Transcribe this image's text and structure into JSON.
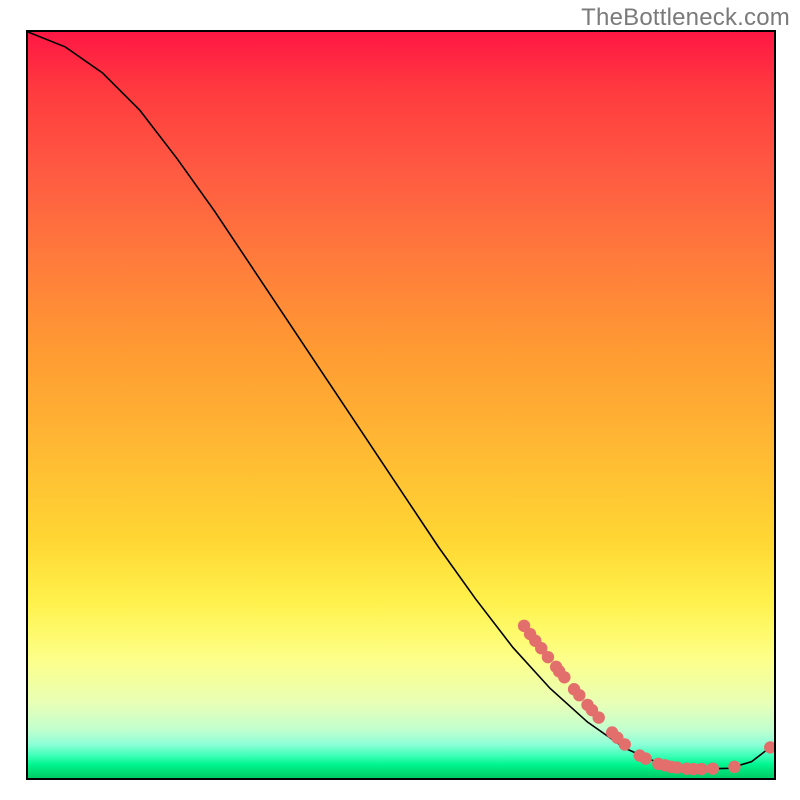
{
  "watermark": "TheBottleneck.com",
  "chart_data": {
    "type": "line",
    "title": "",
    "xlabel": "",
    "ylabel": "",
    "xlim": [
      0,
      100
    ],
    "ylim": [
      0,
      100
    ],
    "series": [
      {
        "name": "bottleneck-curve",
        "points": [
          {
            "x": 0,
            "y": 100
          },
          {
            "x": 5,
            "y": 98
          },
          {
            "x": 10,
            "y": 94.5
          },
          {
            "x": 15,
            "y": 89.5
          },
          {
            "x": 20,
            "y": 83
          },
          {
            "x": 25,
            "y": 76
          },
          {
            "x": 30,
            "y": 68.5
          },
          {
            "x": 35,
            "y": 61
          },
          {
            "x": 40,
            "y": 53.5
          },
          {
            "x": 45,
            "y": 46
          },
          {
            "x": 50,
            "y": 38.5
          },
          {
            "x": 55,
            "y": 31
          },
          {
            "x": 60,
            "y": 24
          },
          {
            "x": 65,
            "y": 17.5
          },
          {
            "x": 70,
            "y": 12
          },
          {
            "x": 75,
            "y": 7.5
          },
          {
            "x": 80,
            "y": 4
          },
          {
            "x": 85,
            "y": 1.8
          },
          {
            "x": 90,
            "y": 1.2
          },
          {
            "x": 94,
            "y": 1.3
          },
          {
            "x": 97,
            "y": 2.2
          },
          {
            "x": 100,
            "y": 4.5
          }
        ]
      }
    ],
    "markers": [
      {
        "x": 66.5,
        "y": 20.4
      },
      {
        "x": 67.3,
        "y": 19.3
      },
      {
        "x": 68.0,
        "y": 18.4
      },
      {
        "x": 68.8,
        "y": 17.4
      },
      {
        "x": 69.7,
        "y": 16.2
      },
      {
        "x": 70.8,
        "y": 14.9
      },
      {
        "x": 71.2,
        "y": 14.3
      },
      {
        "x": 71.9,
        "y": 13.5
      },
      {
        "x": 73.2,
        "y": 11.9
      },
      {
        "x": 73.9,
        "y": 11.1
      },
      {
        "x": 75.0,
        "y": 9.8
      },
      {
        "x": 75.6,
        "y": 9.1
      },
      {
        "x": 76.5,
        "y": 8.1
      },
      {
        "x": 78.3,
        "y": 6.1
      },
      {
        "x": 79.0,
        "y": 5.4
      },
      {
        "x": 80.0,
        "y": 4.5
      },
      {
        "x": 82.0,
        "y": 3.0
      },
      {
        "x": 82.8,
        "y": 2.6
      },
      {
        "x": 84.5,
        "y": 1.9
      },
      {
        "x": 85.4,
        "y": 1.7
      },
      {
        "x": 86.2,
        "y": 1.5
      },
      {
        "x": 87.0,
        "y": 1.4
      },
      {
        "x": 88.3,
        "y": 1.25
      },
      {
        "x": 89.2,
        "y": 1.2
      },
      {
        "x": 90.3,
        "y": 1.2
      },
      {
        "x": 91.8,
        "y": 1.25
      },
      {
        "x": 94.7,
        "y": 1.5
      },
      {
        "x": 99.5,
        "y": 4.1
      }
    ]
  }
}
